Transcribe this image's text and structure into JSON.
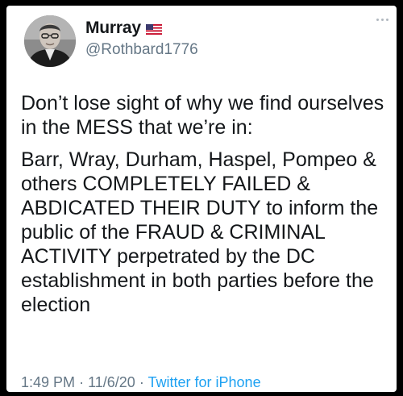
{
  "tweet": {
    "author": {
      "display_name": "Murray",
      "flag_icon": "us-flag-icon",
      "handle": "@Rothbard1776"
    },
    "paragraphs": [
      "Don’t lose sight of why we find ourselves in the MESS that we’re in:",
      "Barr, Wray, Durham, Haspel, Pompeo & others COMPLETELY FAILED & ABDICATED THEIR DUTY to inform the public of the FRAUD & CRIMINAL ACTIVITY perpetrated by the DC establishment in both parties before the election"
    ],
    "time": "1:49 PM",
    "date": "11/6/20",
    "separator": "·",
    "source": "Twitter for iPhone",
    "more_icon": "more-options-icon"
  },
  "colors": {
    "text_primary": "#14171a",
    "text_secondary": "#657786",
    "link": "#1da1f2",
    "background": "#ffffff",
    "frame": "#000000"
  }
}
